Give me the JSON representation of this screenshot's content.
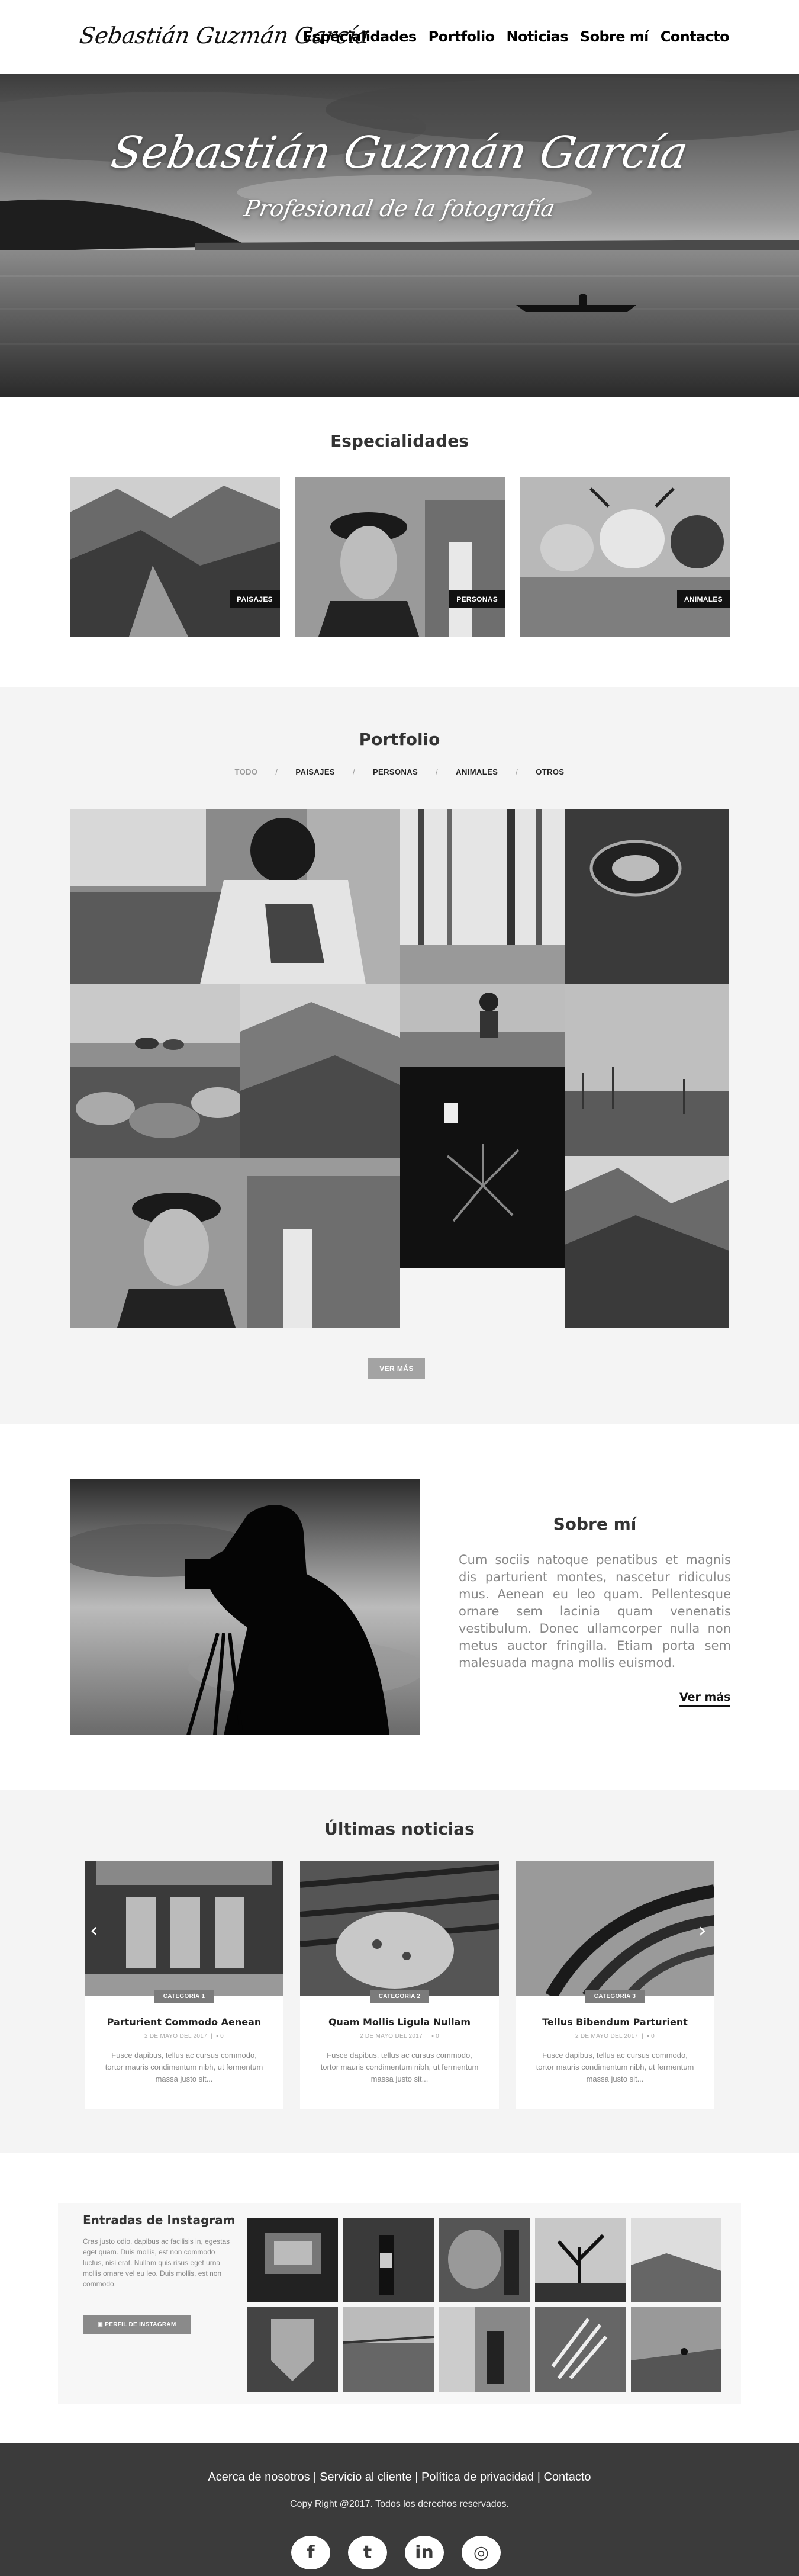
{
  "header": {
    "logo": "Sebastián Guzmán García",
    "nav": [
      "Especialidades",
      "Portfolio",
      "Noticias",
      "Sobre mí",
      "Contacto"
    ]
  },
  "hero": {
    "title": "Sebastián Guzmán García",
    "subtitle": "Profesional de la fotografía"
  },
  "specialties": {
    "title": "Especialidades",
    "items": [
      "PAISAJES",
      "PERSONAS",
      "ANIMALES"
    ]
  },
  "portfolio": {
    "title": "Portfolio",
    "filters": [
      "TODO",
      "PAISAJES",
      "PERSONAS",
      "ANIMALES",
      "OTROS"
    ],
    "active_filter": "TODO",
    "more_button": "VER MÁS"
  },
  "about": {
    "title": "Sobre mí",
    "text": "Cum sociis natoque penatibus et magnis dis parturient montes, nascetur ridiculus mus. Aenean eu leo quam. Pellentesque ornare sem lacinia quam venenatis vestibulum. Donec ullamcorper nulla non metus auctor fringilla. Etiam porta sem malesuada magna mollis euismod.",
    "more": "Ver más"
  },
  "news": {
    "title": "Últimas noticias",
    "items": [
      {
        "category": "CATEGORÍA 1",
        "title": "Parturient Commodo Aenean",
        "date": "2 DE MAYO DEL 2017",
        "comments": "0",
        "excerpt": "Fusce dapibus, tellus ac cursus commodo, tortor mauris condimentum nibh, ut fermentum massa justo sit..."
      },
      {
        "category": "CATEGORÍA 2",
        "title": "Quam Mollis Ligula Nullam",
        "date": "2 DE MAYO DEL 2017",
        "comments": "0",
        "excerpt": "Fusce dapibus, tellus ac cursus commodo, tortor mauris condimentum nibh, ut fermentum massa justo sit..."
      },
      {
        "category": "CATEGORÍA 3",
        "title": "Tellus Bibendum Parturient",
        "date": "2 DE MAYO DEL 2017",
        "comments": "0",
        "excerpt": "Fusce dapibus, tellus ac cursus commodo, tortor mauris condimentum nibh, ut fermentum massa justo sit..."
      }
    ],
    "prev_arrow": "‹",
    "next_arrow": "›"
  },
  "instagram": {
    "title": "Entradas de Instagram",
    "text": "Cras justo odio, dapibus ac facilisis in, egestas eget quam. Duis mollis, est non commodo luctus, nisi erat. Nullam quis risus eget urna mollis ornare vel eu leo. Duis mollis, est non commodo.",
    "button": "PERFIL DE INSTAGRAM"
  },
  "footer": {
    "links": [
      "Acerca de nosotros",
      "Servicio al cliente",
      "Política de privacidad",
      "Contacto"
    ],
    "copyright": "Copy Right @2017. Todos los derechos reservados.",
    "socials": [
      {
        "icon": "facebook-icon",
        "glyph": "f"
      },
      {
        "icon": "twitter-icon",
        "glyph": "t"
      },
      {
        "icon": "linkedin-icon",
        "glyph": "in"
      },
      {
        "icon": "instagram-icon",
        "glyph": "◎"
      }
    ]
  }
}
